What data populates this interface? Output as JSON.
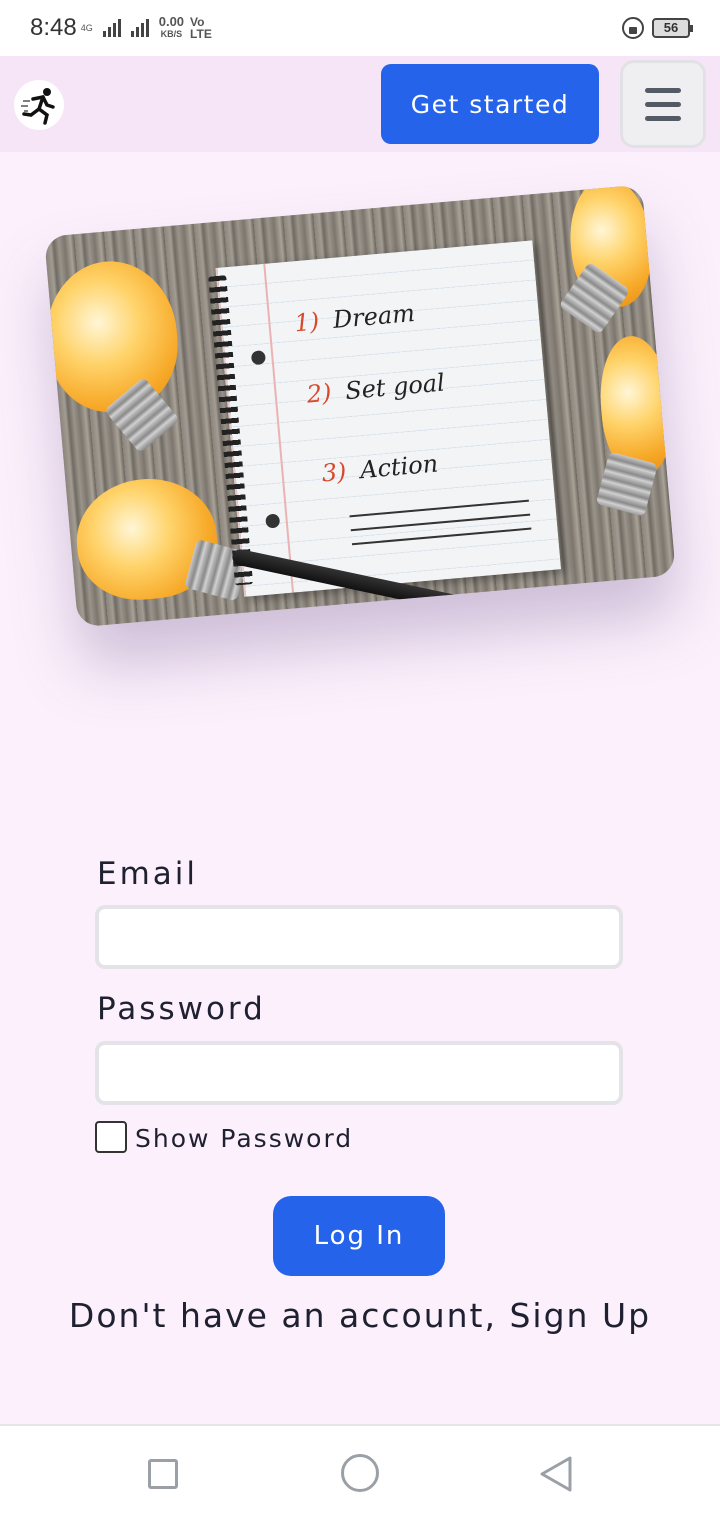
{
  "status_bar": {
    "time": "8:48",
    "network_label": "4G",
    "speed_value": "0.00",
    "speed_unit": "KB/S",
    "volte": "Vo",
    "lte": "LTE",
    "battery": "56"
  },
  "header": {
    "logo_icon": "running-man-icon",
    "get_started_label": "Get started",
    "menu_icon": "hamburger-menu-icon"
  },
  "hero": {
    "items": [
      {
        "num": "1)",
        "text": "Dream"
      },
      {
        "num": "2)",
        "text": "Set goal"
      },
      {
        "num": "3)",
        "text": "Action"
      }
    ]
  },
  "form": {
    "email_label": "Email",
    "email_value": "",
    "password_label": "Password",
    "password_value": "",
    "show_password_label": "Show Password",
    "show_password_checked": false,
    "login_label": "Log In",
    "signup_prefix": "Don't have an account, ",
    "signup_link": "Sign Up"
  },
  "nav": {
    "recent_icon": "square-recent-apps-icon",
    "home_icon": "circle-home-icon",
    "back_icon": "triangle-back-icon"
  },
  "colors": {
    "accent": "#2563eb",
    "page_bg": "#fcf0fc",
    "header_bg": "#f6e5f7"
  }
}
